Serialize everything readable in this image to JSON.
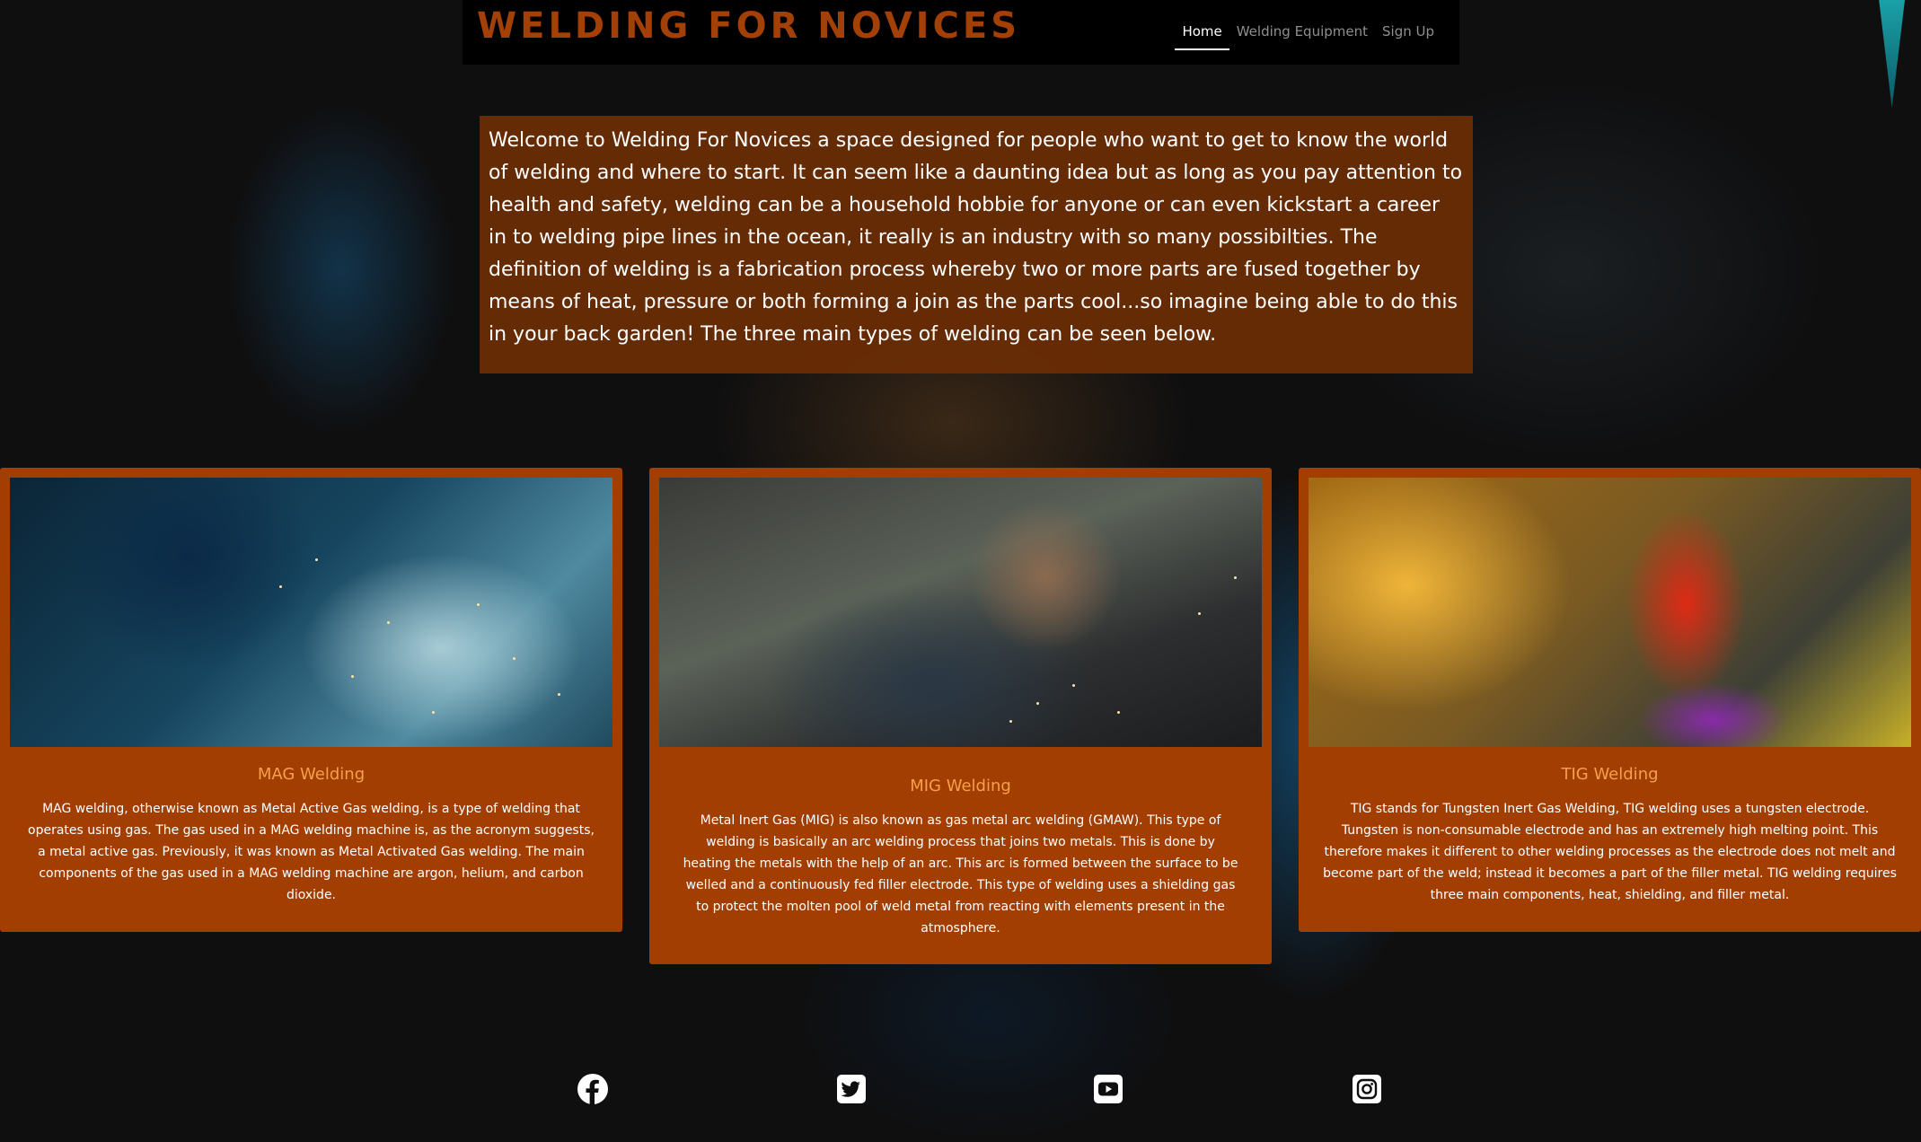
{
  "header": {
    "brand": "WELDING FOR NOVICES",
    "nav": [
      {
        "label": "Home",
        "active": true
      },
      {
        "label": "Welding Equipment",
        "active": false
      },
      {
        "label": "Sign Up",
        "active": false
      }
    ]
  },
  "intro": {
    "text": "Welcome to Welding For Novices a space designed for people who want to get to know the world of welding and where to start. It can seem like a daunting idea but as long as you pay attention to health and safety, welding can be a household hobbie for anyone or can even kickstart a career in to welding pipe lines in the ocean, it really is an industry with so many possibilties. The definition of welding is a fabrication process whereby two or more parts are fused together by means of heat, pressure or both forming a join as the parts cool...so imagine being able to do this in your back garden! The three main types of welding can be seen below."
  },
  "cards": [
    {
      "title": "MAG Welding",
      "text": "MAG welding, otherwise known as Metal Active Gas welding, is a type of welding that operates using gas. The gas used in a MAG welding machine is, as the acronym suggests, a metal active gas. Previously, it was known as Metal Activated Gas welding. The main components of the gas used in a MAG welding machine are argon, helium, and carbon dioxide."
    },
    {
      "title": "MIG Welding",
      "text": "Metal Inert Gas (MIG) is also known as gas metal arc welding (GMAW). This type of welding is basically an arc welding process that joins two metals. This is done by heating the metals with the help of an arc. This arc is formed between the surface to be welled and a continuously fed filler electrode. This type of welding uses a shielding gas to protect the molten pool of weld metal from reacting with elements present in the atmosphere."
    },
    {
      "title": "TIG Welding",
      "text": "TIG stands for Tungsten Inert Gas Welding, TIG welding uses a tungsten electrode. Tungsten is non-consumable electrode and has an extremely high melting point. This therefore makes it different to other welding processes as the electrode does not melt and become part of the weld; instead it becomes a part of the filler metal. TIG welding requires three main components, heat, shielding, and filler metal."
    }
  ],
  "socials": [
    "facebook-icon",
    "twitter-icon",
    "youtube-icon",
    "instagram-icon"
  ],
  "colors": {
    "brand": "#a24005",
    "card_bg": "#a33e03",
    "card_title": "#f5a04a",
    "intro_bg": "#6c2d04",
    "page_bg": "#0e0e0e"
  }
}
